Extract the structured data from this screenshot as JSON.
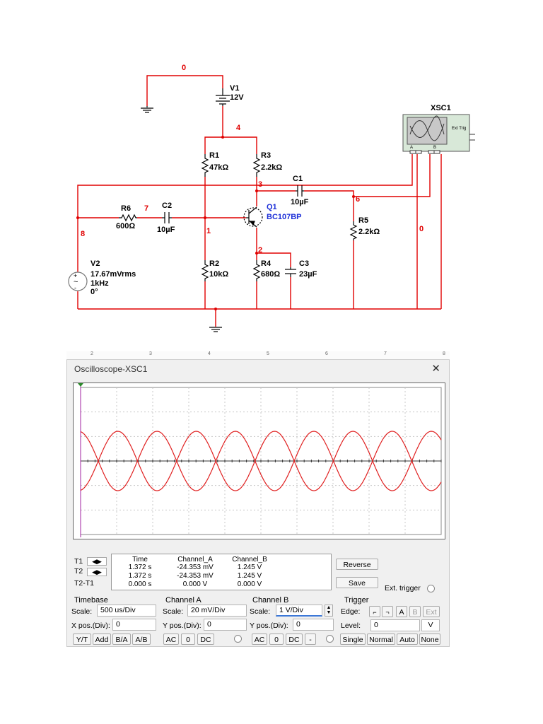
{
  "schematic": {
    "nets": {
      "n0_top": "0",
      "n4": "4",
      "n7": "7",
      "n8": "8",
      "n1": "1",
      "n3": "3",
      "n6": "6",
      "n0_right": "0",
      "n2": "2"
    },
    "v1": {
      "name": "V1",
      "value": "12V"
    },
    "r1": {
      "name": "R1",
      "value": "47kΩ"
    },
    "r3": {
      "name": "R3",
      "value": "2.2kΩ"
    },
    "c1": {
      "name": "C1",
      "value": "10µF"
    },
    "r6": {
      "name": "R6",
      "value": "600Ω"
    },
    "c2": {
      "name": "C2",
      "value": "10µF"
    },
    "q1": {
      "name": "Q1",
      "value": "BC107BP"
    },
    "r5": {
      "name": "R5",
      "value": "2.2kΩ"
    },
    "v2": {
      "name": "V2",
      "line1": "17.67mVrms",
      "line2": "1kHz",
      "line3": "0°"
    },
    "r2": {
      "name": "R2",
      "value": "10kΩ"
    },
    "r4": {
      "name": "R4",
      "value": "680Ω"
    },
    "c3": {
      "name": "C3",
      "value": "23µF"
    },
    "xsc": {
      "name": "XSC1",
      "ext_trig": "Ext Trig",
      "a": "A",
      "b": "B"
    }
  },
  "ruler": {
    "marks": [
      "2",
      "3",
      "4",
      "5",
      "6",
      "7",
      "8"
    ]
  },
  "scope": {
    "title": "Oscilloscope-XSC1",
    "close": "✕",
    "measure": {
      "headers": [
        "Time",
        "Channel_A",
        "Channel_B"
      ],
      "rows": [
        {
          "label": "T1",
          "time": "1.372 s",
          "cha": "-24.353 mV",
          "chb": "1.245 V"
        },
        {
          "label": "T2",
          "time": "1.372 s",
          "cha": "-24.353 mV",
          "chb": "1.245 V"
        },
        {
          "label": "T2-T1",
          "time": "0.000 s",
          "cha": "0.000 V",
          "chb": "0.000 V"
        }
      ]
    },
    "buttons": {
      "reverse": "Reverse",
      "save": "Save",
      "ext_trigger": "Ext. trigger"
    },
    "timebase": {
      "title": "Timebase",
      "scale_label": "Scale:",
      "scale": "500 us/Div",
      "xpos_label": "X pos.(Div):",
      "xpos": "0",
      "yt": "Y/T",
      "add": "Add",
      "ba": "B/A",
      "ab": "A/B"
    },
    "cha": {
      "title": "Channel A",
      "scale_label": "Scale:",
      "scale": "20 mV/Div",
      "ypos_label": "Y pos.(Div):",
      "ypos": "0",
      "ac": "AC",
      "zero": "0",
      "dc": "DC"
    },
    "chb": {
      "title": "Channel B",
      "scale_label": "Scale:",
      "scale": "1  V/Div",
      "ypos_label": "Y pos.(Div):",
      "ypos": "0",
      "ac": "AC",
      "zero": "0",
      "dc": "DC",
      "minus": "-"
    },
    "trigger": {
      "title": "Trigger",
      "edge_label": "Edge:",
      "a": "A",
      "b": "B",
      "ext": "Ext",
      "level_label": "Level:",
      "level": "0",
      "unit": "V",
      "single": "Single",
      "normal": "Normal",
      "auto": "Auto",
      "none": "None"
    },
    "arrows": {
      "left": "◀",
      "right": "▶"
    },
    "traces": {
      "color": "#e02020",
      "cycles": 4.6
    }
  }
}
